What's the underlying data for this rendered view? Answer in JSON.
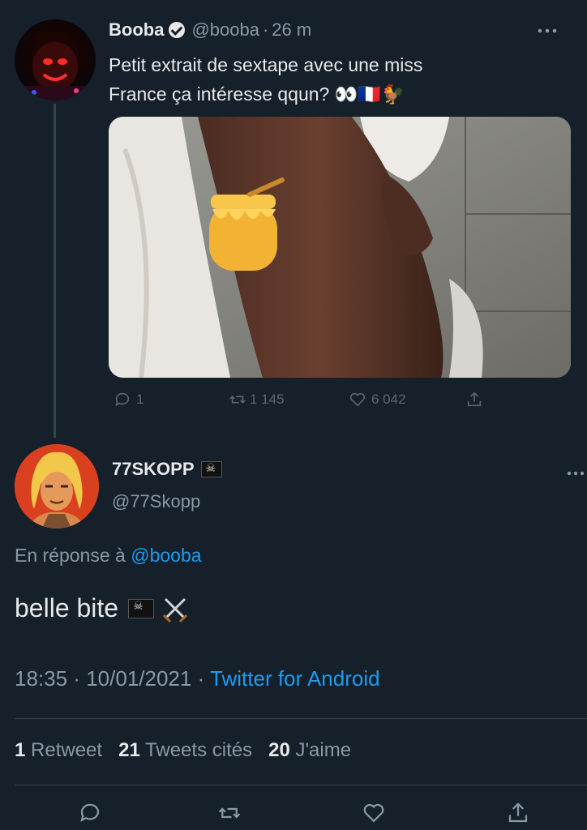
{
  "parent_tweet": {
    "display_name": "Booba",
    "handle": "@booba",
    "separator": "·",
    "time_ago": "26 m",
    "text_line1": "Petit extrait de sextape avec une miss",
    "text_line2": "France ça intéresse qqun? 👀🇫🇷🐓",
    "reply_count": "1",
    "retweet_count": "1 145",
    "like_count": "6 042"
  },
  "reply": {
    "display_name": "77SKOPP",
    "handle": "@77Skopp",
    "reply_prefix": "En réponse à",
    "reply_to": "@booba",
    "text": "belle bite",
    "time": "18:35",
    "date": "10/01/2021",
    "source": "Twitter for Android",
    "meta_sep": "·"
  },
  "stats": {
    "retweets_num": "1",
    "retweets_label": "Retweet",
    "quotes_num": "21",
    "quotes_label": "Tweets cités",
    "likes_num": "20",
    "likes_label": "J'aime"
  },
  "colors": {
    "background": "#15202b",
    "accent": "#1d9bf0",
    "muted": "#8b98a5"
  },
  "icons": [
    "verified-badge-icon",
    "more-icon",
    "reply-icon",
    "retweet-icon",
    "like-icon",
    "share-icon",
    "pirate-flag-icon",
    "crossed-swords-icon"
  ]
}
